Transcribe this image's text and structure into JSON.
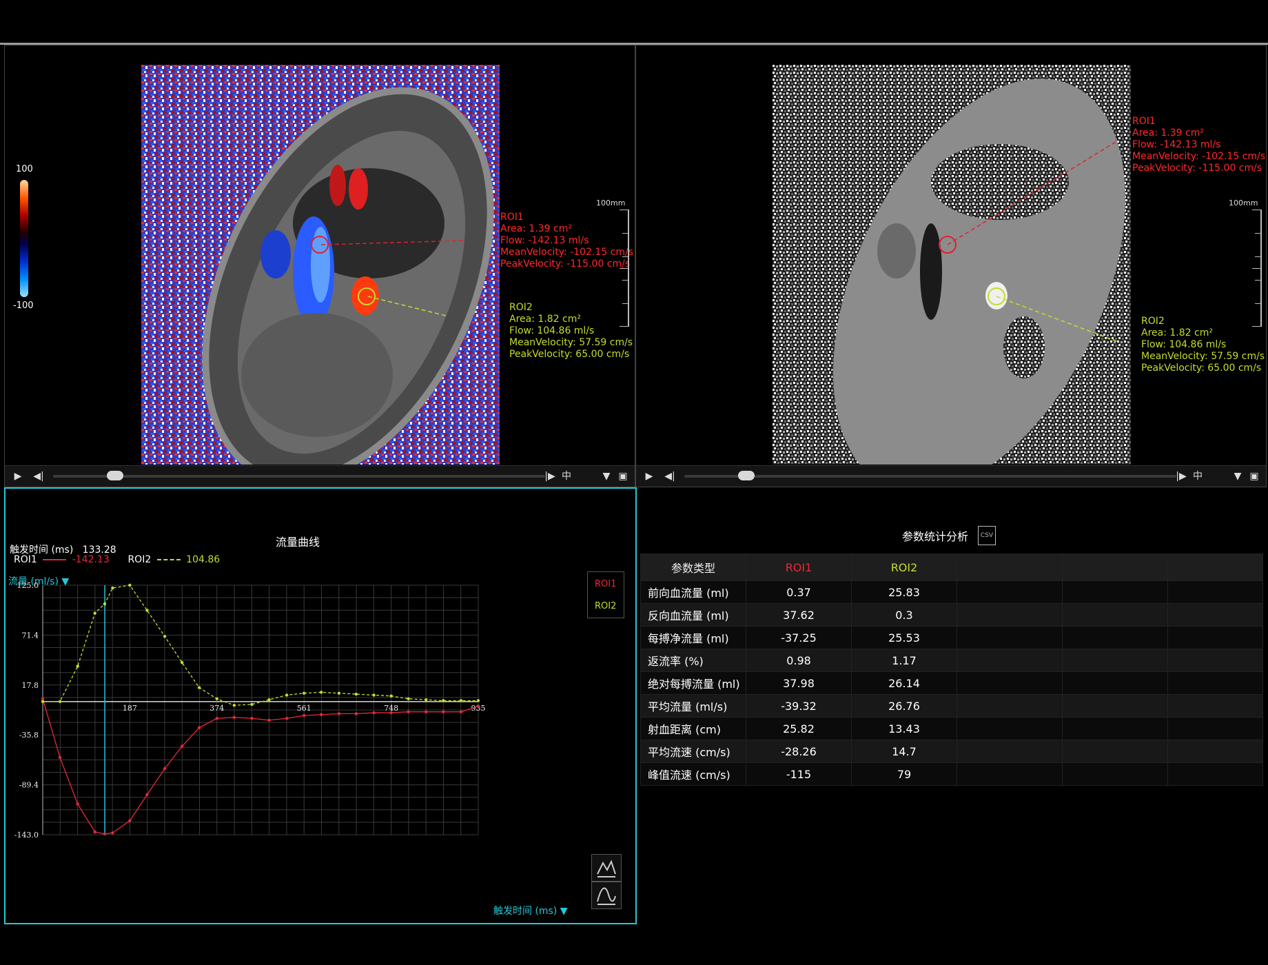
{
  "colorbar": {
    "max": "100",
    "min": "-100"
  },
  "scale_label": "100mm",
  "viewer_left": {
    "roi1": {
      "name": "ROI1",
      "area": "Area: 1.39 cm²",
      "flow": "Flow: -142.13 ml/s",
      "mean": "MeanVelocity: -102.15 cm/s",
      "peak": "PeakVelocity: -115.00 cm/s"
    },
    "roi2": {
      "name": "ROI2",
      "area": "Area: 1.82 cm²",
      "flow": "Flow: 104.86 ml/s",
      "mean": "MeanVelocity: 57.59 cm/s",
      "peak": "PeakVelocity: 65.00 cm/s"
    },
    "controls": {
      "play": "▶",
      "prev": "◀|",
      "next": "|▶",
      "mid": "中",
      "menu": "▼",
      "save": "▣"
    }
  },
  "viewer_right": {
    "roi1": {
      "name": "ROI1",
      "area": "Area: 1.39 cm²",
      "flow": "Flow: -142.13 ml/s",
      "mean": "MeanVelocity: -102.15 cm/s",
      "peak": "PeakVelocity: -115.00 cm/s"
    },
    "roi2": {
      "name": "ROI2",
      "area": "Area: 1.82 cm²",
      "flow": "Flow: 104.86 ml/s",
      "mean": "MeanVelocity: 57.59 cm/s",
      "peak": "PeakVelocity: 65.00 cm/s"
    },
    "controls": {
      "play": "▶",
      "prev": "◀|",
      "next": "|▶",
      "mid": "中",
      "menu": "▼",
      "save": "▣"
    }
  },
  "flow_chart_panel": {
    "title": "流量曲线",
    "trigger_label": "触发时间 (ms)",
    "trigger_value": "133.28",
    "roi1_label": "ROI1",
    "roi1_value": "-142.13",
    "roi2_label": "ROI2",
    "roi2_value": "104.86",
    "y_selector": "流量 (ml/s) ▼",
    "x_selector": "触发时间 (ms) ▼",
    "legend": [
      "ROI1",
      "ROI2"
    ]
  },
  "chart_data": {
    "type": "line",
    "title": "流量曲线",
    "xlabel": "触发时间 (ms)",
    "ylabel": "流量 (ml/s)",
    "ylim": [
      -143.0,
      125.0
    ],
    "xlim": [
      0,
      935
    ],
    "y_ticks": [
      "125.0",
      "71.4",
      "17.8",
      "-35.8",
      "-89.4",
      "-143.0"
    ],
    "x_ticks": [
      "187",
      "374",
      "561",
      "748",
      "935"
    ],
    "cursor_x": 133.28,
    "series": [
      {
        "name": "ROI1",
        "color": "#e8283a",
        "style": "solid",
        "x": [
          0,
          37,
          75,
          112,
          133,
          150,
          187,
          224,
          262,
          299,
          336,
          374,
          411,
          449,
          486,
          524,
          561,
          598,
          636,
          673,
          711,
          748,
          785,
          823,
          860,
          898,
          935
        ],
        "y": [
          3,
          -60,
          -110,
          -140,
          -142.13,
          -141,
          -128,
          -100,
          -72,
          -48,
          -28,
          -18,
          -17,
          -18,
          -20,
          -18,
          -15,
          -14,
          -13,
          -13,
          -12,
          -12,
          -11,
          -11,
          -11,
          -11,
          -5
        ]
      },
      {
        "name": "ROI2",
        "color": "#c7dc2c",
        "style": "dashed",
        "x": [
          0,
          37,
          75,
          112,
          133,
          150,
          187,
          224,
          262,
          299,
          336,
          374,
          411,
          449,
          486,
          524,
          561,
          598,
          636,
          673,
          711,
          748,
          785,
          823,
          860,
          898,
          935
        ],
        "y": [
          0,
          0,
          38,
          95,
          104.86,
          122,
          125,
          98,
          70,
          42,
          15,
          3,
          -4,
          -3,
          2,
          7,
          9,
          10,
          9,
          8,
          7,
          6,
          3,
          2,
          1,
          1,
          1
        ]
      }
    ]
  },
  "stats": {
    "title": "参数统计分析",
    "csv": "CSV",
    "headers": [
      "参数类型",
      "ROI1",
      "ROI2",
      "",
      "",
      ""
    ],
    "rows": [
      [
        "前向血流量 (ml)",
        "0.37",
        "25.83"
      ],
      [
        "反向血流量 (ml)",
        "37.62",
        "0.3"
      ],
      [
        "每搏净流量 (ml)",
        "-37.25",
        "25.53"
      ],
      [
        "返流率 (%)",
        "0.98",
        "1.17"
      ],
      [
        "绝对每搏流量 (ml)",
        "37.98",
        "26.14"
      ],
      [
        "平均流量 (ml/s)",
        "-39.32",
        "26.76"
      ],
      [
        "射血距离 (cm)",
        "25.82",
        "13.43"
      ],
      [
        "平均流速 (cm/s)",
        "-28.26",
        "14.7"
      ],
      [
        "峰值流速 (cm/s)",
        "-115",
        "79"
      ]
    ],
    "header_colors": {
      "roi1": "#e8283a",
      "roi2": "#c7dc2c"
    }
  }
}
